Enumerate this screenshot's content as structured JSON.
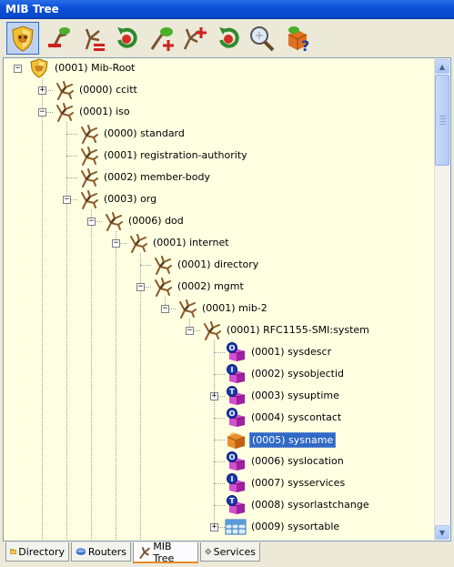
{
  "window": {
    "title": "MIB Tree"
  },
  "toolbar": {
    "buttons": [
      {
        "icon": "mib-root-shield-icon",
        "active": true
      },
      {
        "icon": "remove-branch-icon"
      },
      {
        "icon": "remove-all-branches-icon"
      },
      {
        "icon": "refresh-icon"
      },
      {
        "icon": "add-branch-icon"
      },
      {
        "icon": "add-all-branches-icon"
      },
      {
        "icon": "refresh-red-icon"
      },
      {
        "icon": "search-icon"
      },
      {
        "icon": "help-box-icon"
      }
    ]
  },
  "tree": {
    "nodes": [
      {
        "label": "(0001) Mib-Root",
        "icon": "shield",
        "depth": 0,
        "expander": "minus"
      },
      {
        "label": "(0000) ccitt",
        "icon": "branch",
        "depth": 1,
        "expander": "plus"
      },
      {
        "label": "(0001) iso",
        "icon": "branch",
        "depth": 1,
        "expander": "minus"
      },
      {
        "label": "(0000) standard",
        "icon": "branch",
        "depth": 2,
        "expander": ""
      },
      {
        "label": "(0001) registration-authority",
        "icon": "branch",
        "depth": 2,
        "expander": ""
      },
      {
        "label": "(0002) member-body",
        "icon": "branch",
        "depth": 2,
        "expander": ""
      },
      {
        "label": "(0003) org",
        "icon": "branch",
        "depth": 2,
        "expander": "minus"
      },
      {
        "label": "(0006) dod",
        "icon": "branch",
        "depth": 3,
        "expander": "minus"
      },
      {
        "label": "(0001) internet",
        "icon": "branch",
        "depth": 4,
        "expander": "minus"
      },
      {
        "label": "(0001) directory",
        "icon": "branch",
        "depth": 5,
        "expander": ""
      },
      {
        "label": "(0002) mgmt",
        "icon": "branch",
        "depth": 5,
        "expander": "minus"
      },
      {
        "label": "(0001) mib-2",
        "icon": "branch",
        "depth": 6,
        "expander": "minus"
      },
      {
        "label": "(0001) RFC1155-SMI:system",
        "icon": "branch",
        "depth": 7,
        "expander": "minus"
      },
      {
        "label": "(0001) sysdescr",
        "icon": "leaf-O",
        "depth": 8,
        "expander": ""
      },
      {
        "label": "(0002) sysobjectid",
        "icon": "leaf-I",
        "depth": 8,
        "expander": ""
      },
      {
        "label": "(0003) sysuptime",
        "icon": "leaf-T",
        "depth": 8,
        "expander": "plus"
      },
      {
        "label": "(0004) syscontact",
        "icon": "leaf-O",
        "depth": 8,
        "expander": ""
      },
      {
        "label": "(0005) sysname",
        "icon": "leaf-open",
        "depth": 8,
        "expander": "",
        "selected": true
      },
      {
        "label": "(0006) syslocation",
        "icon": "leaf-O",
        "depth": 8,
        "expander": ""
      },
      {
        "label": "(0007) sysservices",
        "icon": "leaf-I",
        "depth": 8,
        "expander": ""
      },
      {
        "label": "(0008) sysorlastchange",
        "icon": "leaf-T",
        "depth": 8,
        "expander": ""
      },
      {
        "label": "(0009) sysortable",
        "icon": "table",
        "depth": 8,
        "expander": "plus"
      }
    ]
  },
  "tabs": [
    {
      "label": "Directory",
      "icon": "directory-icon"
    },
    {
      "label": "Routers",
      "icon": "routers-icon"
    },
    {
      "label": "MIB Tree",
      "icon": "mib-tree-icon",
      "active": true
    },
    {
      "label": "Services",
      "icon": "services-gear-icon"
    }
  ]
}
